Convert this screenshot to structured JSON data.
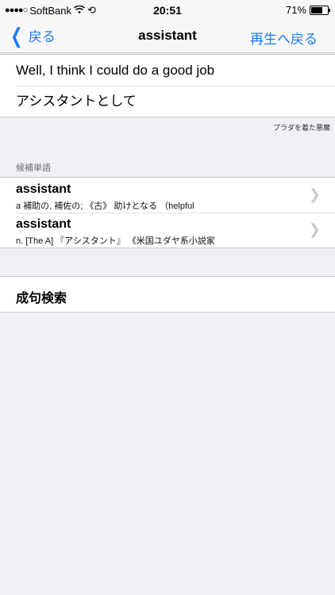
{
  "status_bar": {
    "carrier": "SoftBank",
    "signal": "●●●●○",
    "wifi_icon": "wifi-icon",
    "time": "20:51",
    "battery_percent": "71%",
    "battery_level": 0.71
  },
  "nav": {
    "back_label": "戻る",
    "title": "assistant",
    "right_label": "再生へ戻る"
  },
  "context": {
    "sentence": "Well, I think I could do a good job",
    "translation": "アシスタントとして",
    "source": "プラダを着た悪魔"
  },
  "candidates": {
    "header": "候補単語",
    "items": [
      {
        "word": "assistant",
        "definition": "a 補助の, 補佐の; 《古》 助けとなる （helpful"
      },
      {
        "word": "assistant",
        "definition": "n. [The A] 『アシスタント』 《米国ユダヤ系小説家"
      }
    ]
  },
  "phrase_search": {
    "label": "成句検索"
  }
}
